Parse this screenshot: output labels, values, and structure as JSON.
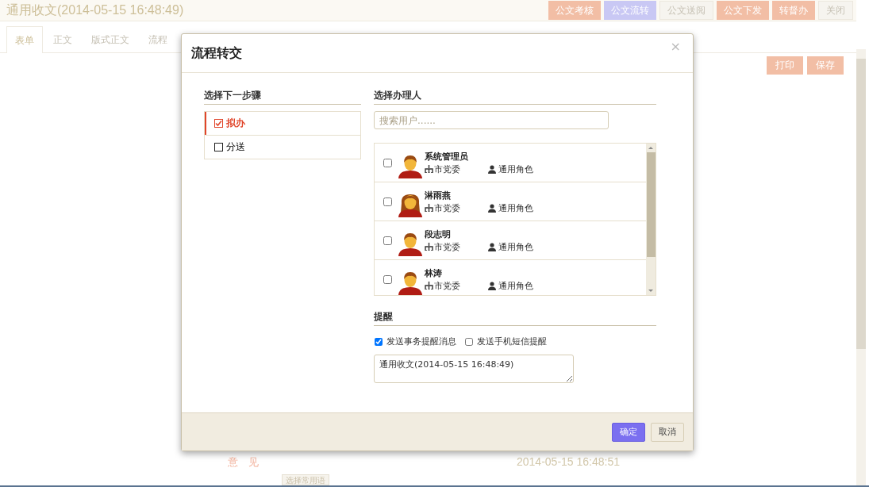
{
  "page": {
    "title": "通用收文(2014-05-15 16:48:49)",
    "actions": [
      {
        "label": "公文考核",
        "kind": "primary"
      },
      {
        "label": "公文流转",
        "kind": "info"
      },
      {
        "label": "公文送阅",
        "kind": "plain"
      },
      {
        "label": "公文下发",
        "kind": "primary"
      },
      {
        "label": "转督办",
        "kind": "primary"
      },
      {
        "label": "关闭",
        "kind": "plain"
      }
    ],
    "tabs": [
      {
        "label": "表单",
        "selected": true
      },
      {
        "label": "正文",
        "selected": false
      },
      {
        "label": "版式正文",
        "selected": false
      },
      {
        "label": "流程",
        "selected": false
      }
    ],
    "form_buttons": [
      "打印",
      "保存"
    ],
    "opinion_label": "意　见",
    "timestamp": "2014-05-15 16:48:51",
    "phrase_button": "选择常用语"
  },
  "dialog": {
    "title": "流程转交",
    "close": "×",
    "steps_title": "选择下一步骤",
    "steps": [
      {
        "label": "拟办",
        "checked": true
      },
      {
        "label": "分送",
        "checked": false
      }
    ],
    "handlers_title": "选择办理人",
    "search": {
      "placeholder": "搜索用户......"
    },
    "users": [
      {
        "name": "系统管理员",
        "kind": "male",
        "dept": "市党委",
        "role": "通用角色",
        "checked": false
      },
      {
        "name": "淋雨燕",
        "kind": "female",
        "dept": "市党委",
        "role": "通用角色",
        "checked": false
      },
      {
        "name": "段志明",
        "kind": "male",
        "dept": "市党委",
        "role": "通用角色",
        "checked": false
      },
      {
        "name": "林涛",
        "kind": "male",
        "dept": "市党委",
        "role": "通用角色",
        "checked": false
      }
    ],
    "reminder_title": "提醒",
    "reminders": [
      {
        "label": "发送事务提醒消息",
        "checked": true
      },
      {
        "label": "发送手机短信提醒",
        "checked": false
      }
    ],
    "message": "通用收文(2014-05-15 16:48:49)",
    "buttons": [
      {
        "label": "确定",
        "kind": "primary"
      },
      {
        "label": "取消",
        "kind": "plain"
      }
    ]
  }
}
